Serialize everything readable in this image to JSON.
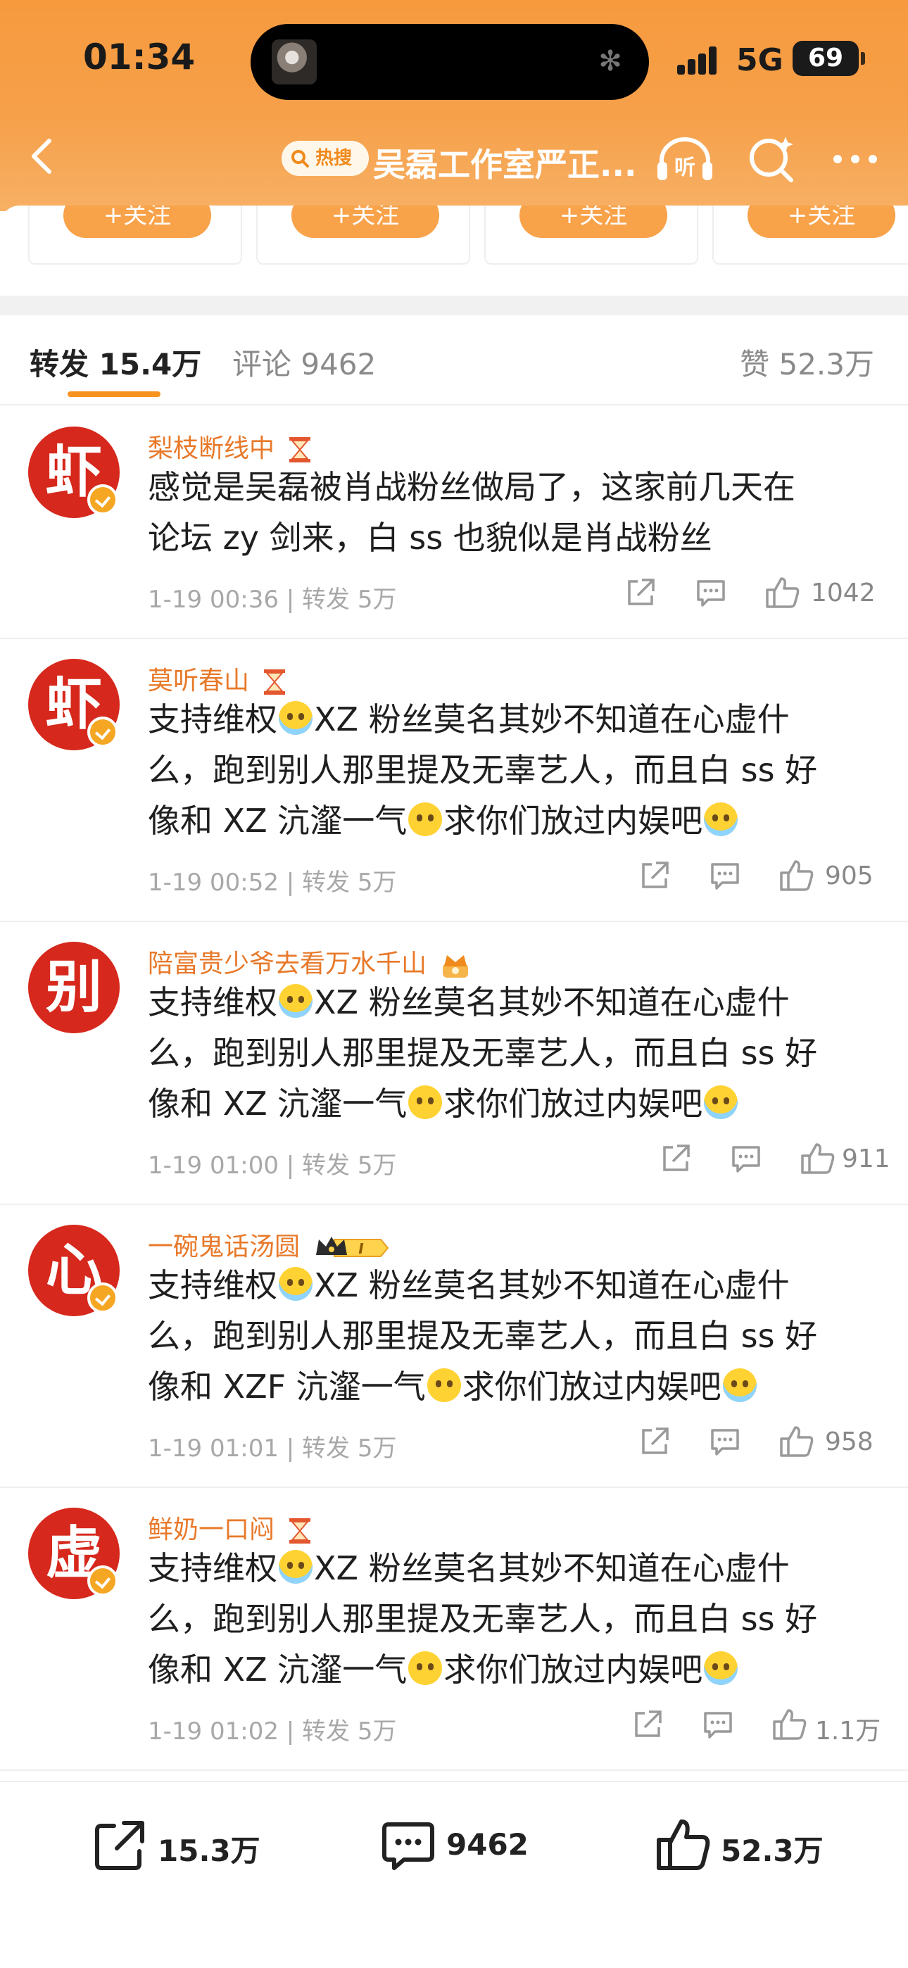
{
  "status_bar": {
    "time": "01:34",
    "network": "5G",
    "battery": "69"
  },
  "nav": {
    "hot_label": "热搜",
    "title": "吴磊工作室严正..."
  },
  "follow_row": {
    "follow_label": "+关注"
  },
  "tabs": {
    "reposts": "转发 15.4万",
    "comments": "评论 9462",
    "likes": "赞 52.3万"
  },
  "reposts": [
    {
      "avatar_char": "虾",
      "username": "梨枝断线中",
      "lines": [
        "感觉是吴磊被肖战粉丝做局了，这家前几天在",
        "论坛 zy 剑来，白 ss 也貌似是肖战粉丝"
      ],
      "time": "1-19 00:36",
      "reposts": "转发 5万",
      "likes": "1042",
      "verified": true
    },
    {
      "avatar_char": "虾",
      "username": "莫听春山",
      "line1_a": "支持维权",
      "line1_b": "XZ 粉丝莫名其妙不知道在心虚什",
      "line2": "么，跑到别人那里提及无辜艺人，而且白 ss 好",
      "line3_a": "像和 XZ 沆瀣一气",
      "line3_b": "求你们放过内娱吧",
      "time": "1-19 00:52",
      "reposts": "转发 5万",
      "likes": "905",
      "verified": true
    },
    {
      "avatar_char": "别",
      "username": "陪富贵少爷去看万水千山",
      "line1_a": "支持维权",
      "line1_b": "XZ 粉丝莫名其妙不知道在心虚什",
      "line2": "么，跑到别人那里提及无辜艺人，而且白 ss 好",
      "line3_a": "像和 XZ 沆瀣一气",
      "line3_b": "求你们放过内娱吧",
      "time": "1-19 01:00",
      "reposts": "转发 5万",
      "likes": "911",
      "verified": false
    },
    {
      "avatar_char": "心",
      "username": "一碗鬼话汤圆",
      "line1_a": "支持维权",
      "line1_b": "XZ 粉丝莫名其妙不知道在心虚什",
      "line2": "么，跑到别人那里提及无辜艺人，而且白 ss 好",
      "line3_a": "像和 XZF 沆瀣一气",
      "line3_b": "求你们放过内娱吧",
      "time": "1-19 01:01",
      "reposts": "转发 5万",
      "likes": "958",
      "verified": true
    },
    {
      "avatar_char": "虚",
      "username": "鲜奶一口闷",
      "line1_a": "支持维权",
      "line1_b": "XZ 粉丝莫名其妙不知道在心虚什",
      "line2": "么，跑到别人那里提及无辜艺人，而且白 ss 好",
      "line3_a": "像和 XZ 沆瀣一气",
      "line3_b": "求你们放过内娱吧",
      "time": "1-19 01:02",
      "reposts": "转发 5万",
      "likes": "1.1万",
      "verified": true
    }
  ],
  "bottom_bar": {
    "repost_count": "15.3万",
    "comment_count": "9462",
    "like_count": "52.3万"
  },
  "colors": {
    "header": "#f79a3e",
    "accent": "#f7931e",
    "username": "#e8792a",
    "avatar_red": "#d6281c"
  },
  "icons": [
    "back-icon",
    "search-icon",
    "headphones-icon",
    "ai-search-icon",
    "more-icon",
    "share-icon",
    "comment-icon",
    "thumbs-up-icon",
    "hourglass-icon",
    "vip-crown-icon",
    "crown-badge-icon"
  ]
}
